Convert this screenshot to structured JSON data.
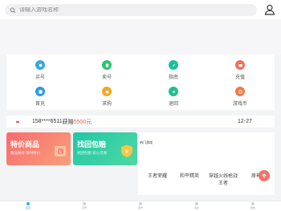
{
  "search": {
    "placeholder": "请输入游戏名称"
  },
  "menu": [
    {
      "label": "买号",
      "color": "#36a9e1"
    },
    {
      "label": "卖号",
      "color": "#2fc36b"
    },
    {
      "label": "指南",
      "color": "#17c29a"
    },
    {
      "label": "充值",
      "color": "#f0705e"
    },
    {
      "label": "首充",
      "color": "#2a9ae6"
    },
    {
      "label": "求购",
      "color": "#f5a623"
    },
    {
      "label": "退回",
      "color": "#1fbf8f"
    },
    {
      "label": "游戏币",
      "color": "#f07a4a"
    }
  ],
  "notice": {
    "tag": "",
    "tag2": "",
    "phone": "158****6511",
    "won": "获赔",
    "amount": "5500元",
    "date": "12-27"
  },
  "promos": [
    {
      "title": "特价商品",
      "subtitle": "精品账号 限时特价",
      "color": "#fb6a6e"
    },
    {
      "title": "找回包赔",
      "subtitle": "找回包赔 安心交易",
      "color": "#20c7a6"
    }
  ],
  "hot": {
    "title": "热门游戏",
    "items": [
      "王者荣耀",
      "和平精英",
      "穿越火线枪战王者",
      "原神"
    ]
  },
  "tabs": [
    "首页",
    "买号",
    "卖号",
    "消息",
    "我的"
  ]
}
